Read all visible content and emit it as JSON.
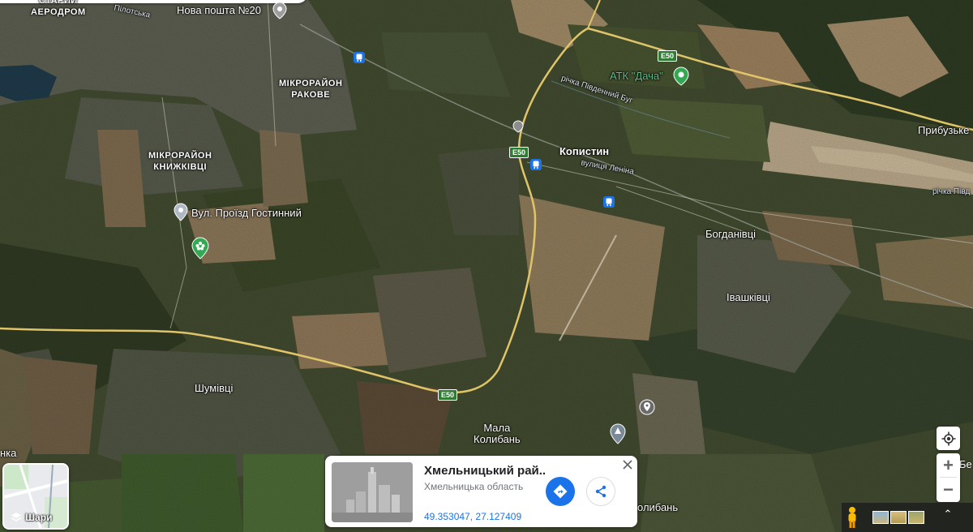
{
  "map": {
    "places": {
      "staryi_aerodrom": "СТАРИЙ\nАЕРОДРОМ",
      "pilotska": "Пілотська",
      "nova_poshta": "Нова пошта №20",
      "mikroraion_rakove": "МІКРОРАЙОН\nРАКОВЕ",
      "atk_dacha": "АТК \"Дача\"",
      "rivers_upper": "річка Південний Буг",
      "prybuzke": "Прибузьке",
      "mikroraion_knyzhkivtsi": "МІКРОРАЙОН\nКНИЖКІВЦІ",
      "kopystyn": "Копистин",
      "vulytsia_lenina": "вулиця Леніна",
      "rivers_right": "річка Півд",
      "vul_proizd": "Вул. Проїзд Гостинний",
      "bogdanivtsi": "Богданівці",
      "ivashkivtsi": "Івашківці",
      "shumivtsi": "Шумівці",
      "mala_kolyban": "Мала\nКолибань",
      "kolyban_bottom": "олибань",
      "left_edge": "нка",
      "right_edge_be": "Бе"
    },
    "highway_badges": {
      "e50_top": "E50",
      "e50_mid": "E50",
      "e50_bottom": "E50"
    }
  },
  "layers_button": {
    "label": "Шари"
  },
  "info_card": {
    "title": "Хмельницький рай...",
    "subtitle": "Хмельницька область",
    "coords": "49.353047, 27.127409"
  },
  "controls": {
    "zoom_in": "+",
    "zoom_out": "−",
    "expand": "⌃"
  },
  "colors": {
    "accent": "#1a73e8",
    "road": "#e0c46a",
    "highway_badge": "#2e7d32"
  }
}
